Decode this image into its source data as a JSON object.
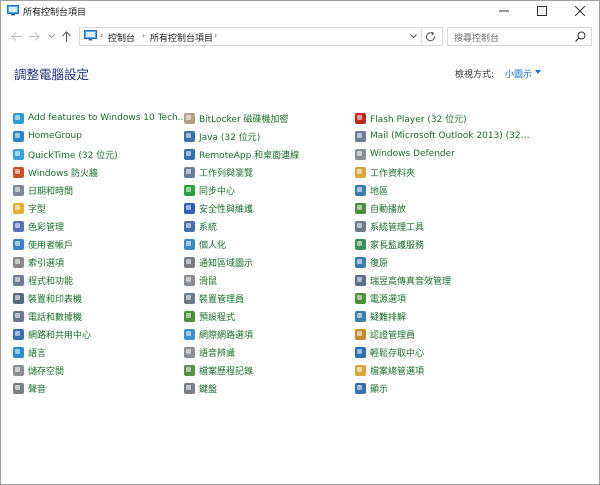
{
  "window": {
    "title": "所有控制台項目",
    "controls": {
      "minimize": "minimize-icon",
      "maximize": "maximize-icon",
      "close": "close-icon"
    }
  },
  "nav": {
    "breadcrumb": [
      "控制台",
      "所有控制台項目"
    ],
    "search_placeholder": "搜尋控制台"
  },
  "header": {
    "title": "調整電腦設定",
    "view_label": "檢視方式:",
    "view_value": "小圖示"
  },
  "colors": {
    "link": "#1a6e2a",
    "heading": "#1e3287",
    "accent": "#1e6fc7"
  },
  "columns": [
    [
      {
        "label": "Add features to Windows 10 Tech...",
        "icon": "add-features-icon",
        "color": "#2f9bd6"
      },
      {
        "label": "HomeGroup",
        "icon": "homegroup-icon",
        "color": "#2a86c8"
      },
      {
        "label": "QuickTime (32 位元)",
        "icon": "quicktime-icon",
        "color": "#3aa0e0"
      },
      {
        "label": "Windows 防火牆",
        "icon": "firewall-icon",
        "color": "#c9502a"
      },
      {
        "label": "日期和時間",
        "icon": "clock-icon",
        "color": "#7a8aa0"
      },
      {
        "label": "字型",
        "icon": "fonts-icon",
        "color": "#e0b030"
      },
      {
        "label": "色彩管理",
        "icon": "color-management-icon",
        "color": "#5a6fc0"
      },
      {
        "label": "使用者帳戶",
        "icon": "user-accounts-icon",
        "color": "#3d7fc9"
      },
      {
        "label": "索引選項",
        "icon": "indexing-icon",
        "color": "#8a8a8a"
      },
      {
        "label": "程式和功能",
        "icon": "programs-icon",
        "color": "#6d7f95"
      },
      {
        "label": "裝置和印表機",
        "icon": "printer-icon",
        "color": "#5b6b7b"
      },
      {
        "label": "電話和數據機",
        "icon": "phone-modem-icon",
        "color": "#6a7a8a"
      },
      {
        "label": "網路和共用中心",
        "icon": "network-icon",
        "color": "#3a6fb0"
      },
      {
        "label": "語言",
        "icon": "language-icon",
        "color": "#2f8ad0"
      },
      {
        "label": "儲存空間",
        "icon": "storage-icon",
        "color": "#8a8f96"
      },
      {
        "label": "聲音",
        "icon": "sound-icon",
        "color": "#7a7f86"
      }
    ],
    [
      {
        "label": "BitLocker 磁碟機加密",
        "icon": "bitlocker-icon",
        "color": "#b0a080"
      },
      {
        "label": "Java (32 位元)",
        "icon": "java-icon",
        "color": "#3c6fa8"
      },
      {
        "label": "RemoteApp 和桌面連線",
        "icon": "remoteapp-icon",
        "color": "#3a6fb0"
      },
      {
        "label": "工作列與瀏覽",
        "icon": "taskbar-icon",
        "color": "#6a7f99"
      },
      {
        "label": "同步中心",
        "icon": "sync-icon",
        "color": "#2f9e3f"
      },
      {
        "label": "安全性與維護",
        "icon": "flag-icon",
        "color": "#2f5fbf"
      },
      {
        "label": "系統",
        "icon": "system-icon",
        "color": "#4a70b0"
      },
      {
        "label": "個人化",
        "icon": "personalization-icon",
        "color": "#3a8ac0"
      },
      {
        "label": "通知區域圖示",
        "icon": "notification-icon",
        "color": "#7a7f86"
      },
      {
        "label": "滑鼠",
        "icon": "mouse-icon",
        "color": "#8a8f96"
      },
      {
        "label": "裝置管理員",
        "icon": "device-manager-icon",
        "color": "#6a7a8a"
      },
      {
        "label": "預設程式",
        "icon": "default-programs-icon",
        "color": "#4a8f3a"
      },
      {
        "label": "網際網路選項",
        "icon": "internet-options-icon",
        "color": "#3a8fd0"
      },
      {
        "label": "語音辨識",
        "icon": "microphone-icon",
        "color": "#8a8f96"
      },
      {
        "label": "檔案歷程記錄",
        "icon": "file-history-icon",
        "color": "#5a8f4a"
      },
      {
        "label": "鍵盤",
        "icon": "keyboard-icon",
        "color": "#7a7f86"
      }
    ],
    [
      {
        "label": "Flash Player (32 位元)",
        "icon": "flash-icon",
        "color": "#c0281e"
      },
      {
        "label": "Mail (Microsoft Outlook 2013) (32 ...",
        "icon": "mail-icon",
        "color": "#6a7f99"
      },
      {
        "label": "Windows Defender",
        "icon": "defender-icon",
        "color": "#8a8f96"
      },
      {
        "label": "工作資料夾",
        "icon": "work-folders-icon",
        "color": "#d8a63a"
      },
      {
        "label": "地區",
        "icon": "region-icon",
        "color": "#3a7fb0"
      },
      {
        "label": "自動播放",
        "icon": "autoplay-icon",
        "color": "#4a8f3a"
      },
      {
        "label": "系統管理工具",
        "icon": "admin-tools-icon",
        "color": "#6a7a8a"
      },
      {
        "label": "家長監護服務",
        "icon": "family-safety-icon",
        "color": "#3a8f5a"
      },
      {
        "label": "復原",
        "icon": "recovery-icon",
        "color": "#3a7fb0"
      },
      {
        "label": "瑞昱高傳真音效管理",
        "icon": "realtek-audio-icon",
        "color": "#5a6f8a"
      },
      {
        "label": "電源選項",
        "icon": "power-icon",
        "color": "#4a8f3a"
      },
      {
        "label": "疑難排解",
        "icon": "troubleshooting-icon",
        "color": "#3a7fb0"
      },
      {
        "label": "認證管理員",
        "icon": "credential-manager-icon",
        "color": "#c0902a"
      },
      {
        "label": "輕鬆存取中心",
        "icon": "ease-of-access-icon",
        "color": "#2f6fb0"
      },
      {
        "label": "檔案總管選項",
        "icon": "folder-options-icon",
        "color": "#d8a63a"
      },
      {
        "label": "顯示",
        "icon": "display-icon",
        "color": "#3a6fb0"
      }
    ]
  ]
}
